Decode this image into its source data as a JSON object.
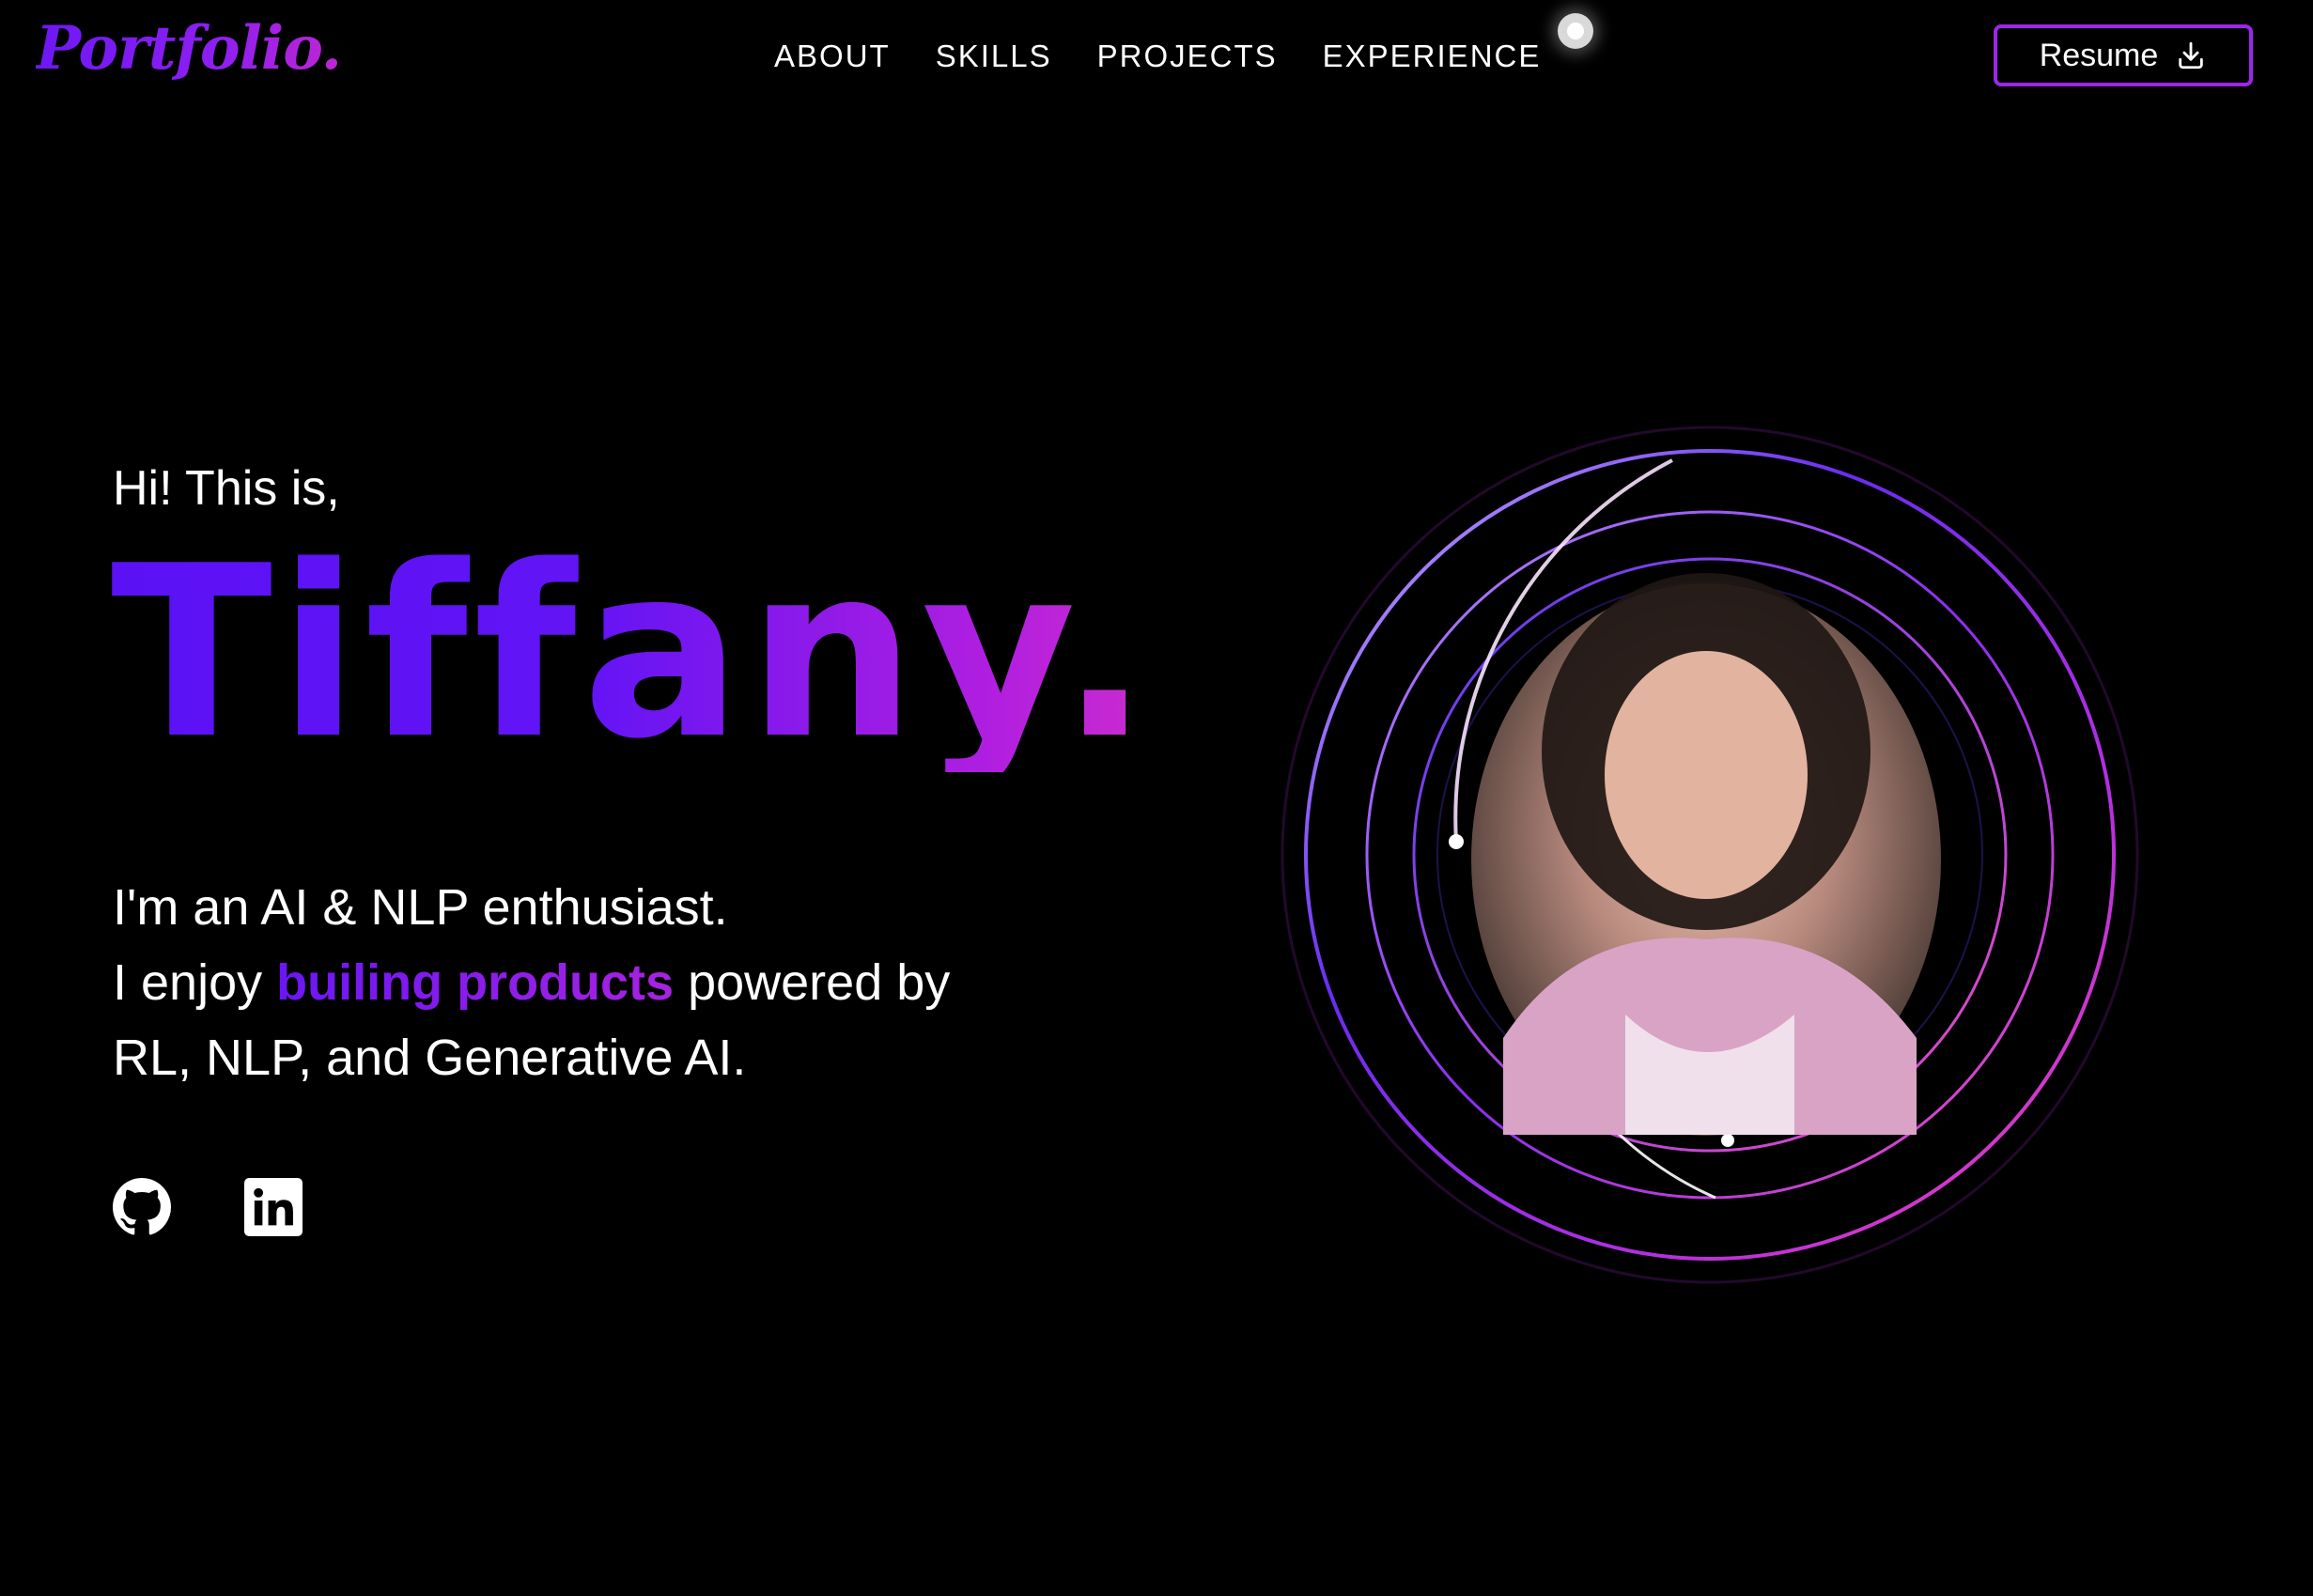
{
  "header": {
    "logo": "Portfolio.",
    "nav": [
      "ABOUT",
      "SKILLS",
      "PROJECTS",
      "EXPERIENCE"
    ],
    "resume_label": "Resume"
  },
  "hero": {
    "greeting": "Hi! This is,",
    "name": "Tiffany.",
    "line1": "I'm an AI & NLP enthusiast.",
    "line2_prefix": "I enjoy ",
    "line2_highlight": "builing products",
    "line2_suffix": " powered by",
    "line3": "RL, NLP, and Generative AI."
  },
  "colors": {
    "accent_purple": "#6214f5",
    "accent_magenta": "#cc2ccd",
    "background": "#000000"
  },
  "icons": [
    "github-icon",
    "linkedin-icon",
    "download-icon",
    "theme-toggle-icon"
  ]
}
